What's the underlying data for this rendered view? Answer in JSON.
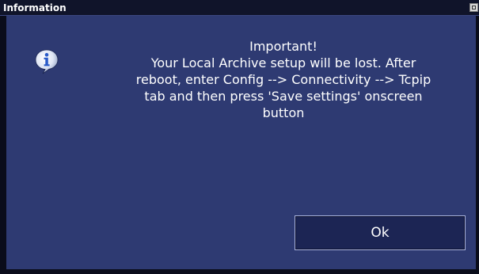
{
  "window": {
    "title": "Information",
    "close_icon": "window-close-icon"
  },
  "content": {
    "icon": "information-icon",
    "heading": "Important!",
    "message_lines": [
      "Your Local Archive setup will be lost. After",
      "reboot, enter Config --> Connectivity --> Tcpip",
      "tab and then press 'Save settings' onscreen",
      "button"
    ]
  },
  "buttons": {
    "ok_label": "Ok"
  },
  "colors": {
    "dialog_background": "#2e3a72",
    "titlebar_background": "#10142a",
    "button_background": "#1c2554",
    "text": "#ffffff"
  }
}
